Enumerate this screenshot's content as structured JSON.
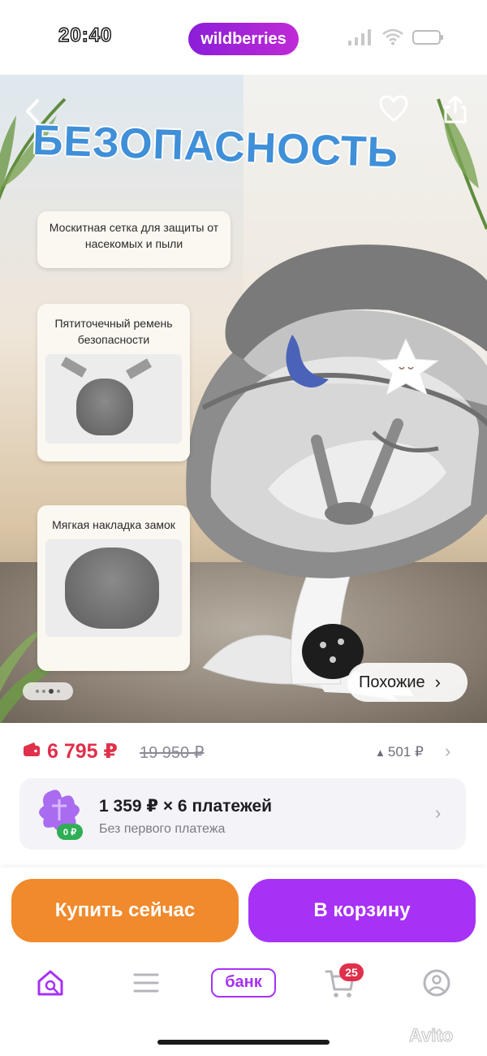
{
  "status_bar": {
    "time": "20:40",
    "brand": "wildberries"
  },
  "product_image": {
    "headline": "БЕЗОПАСНОСТЬ",
    "callouts": [
      "Москитная сетка для защиты от насекомых и пыли",
      "Пятиточечный ремень безопасности",
      "Мягкая накладка замок"
    ],
    "similar_label": "Похожие",
    "slide_indicator": {
      "total": 4,
      "active": 3
    }
  },
  "price": {
    "current": "6 795 ₽",
    "old": "19 950 ₽",
    "increase": "501 ₽"
  },
  "installment": {
    "title": "1 359 ₽ × 6 платежей",
    "subtitle": "Без первого платежа",
    "badge": "0 ₽"
  },
  "actions": {
    "buy_now": "Купить сейчас",
    "add_to_cart": "В корзину"
  },
  "bottom_nav": {
    "bank": "банк",
    "cart_count": "25"
  },
  "watermark": "Avito",
  "colors": {
    "brand_purple": "#a731f5",
    "buy_orange": "#f08a2c",
    "price_red": "#e0304b"
  }
}
